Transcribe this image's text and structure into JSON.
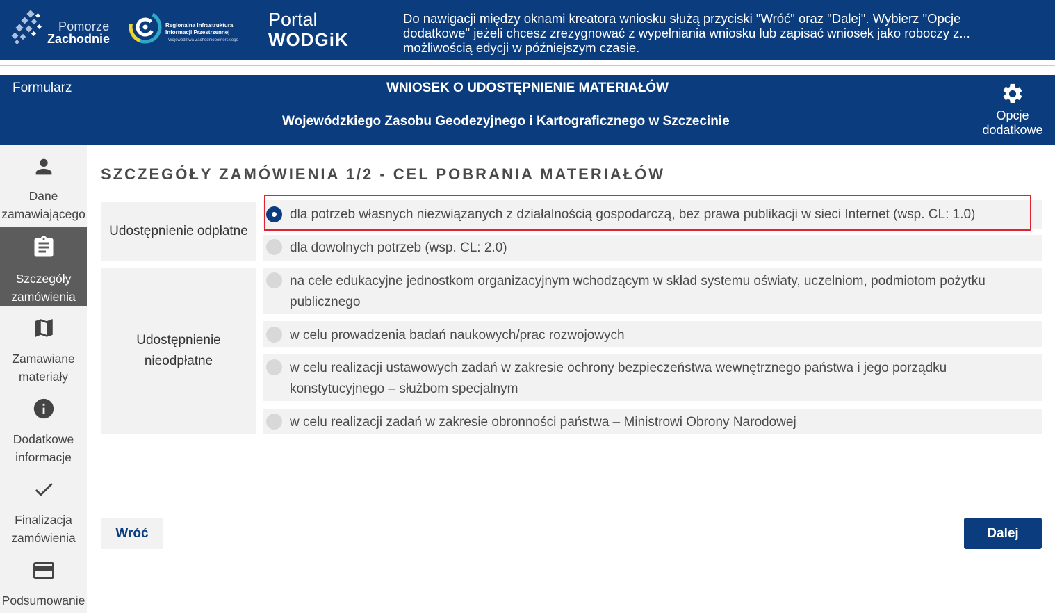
{
  "header": {
    "logo_pomorze_line1": "Pomorze",
    "logo_pomorze_line2": "Zachodnie",
    "logo_riip_line1": "Regionalna Infrastruktura",
    "logo_riip_line2": "Informacji Przestrzennej",
    "logo_riip_line3": "Województwa Zachodniopomorskiego",
    "portal_line1": "Portal",
    "portal_line2": "WODGiK",
    "info": "Do nawigacji między oknami kreatora wniosku służą przyciski \"Wróć\" oraz \"Dalej\". Wybierz \"Opcje dodatkowe\" jeżeli chcesz zrezygnować z wypełniania wniosku lub zapisać wniosek jako roboczy z... możliwością edycji w późniejszym czasie."
  },
  "form_header": {
    "label": "Formularz",
    "title": "WNIOSEK O UDOSTĘPNIENIE MATERIAŁÓW",
    "subtitle": "Wojewódzkiego Zasobu Geodezyjnego i Kartograficznego w Szczecinie",
    "options_line1": "Opcje",
    "options_line2": "dodatkowe",
    "options_icon": "gear-icon"
  },
  "sidebar": {
    "steps": [
      {
        "line1": "Dane",
        "line2": "zamawiającego",
        "icon": "person-icon",
        "active": false
      },
      {
        "line1": "Szczegóły",
        "line2": "zamówienia",
        "icon": "clipboard-icon",
        "active": true
      },
      {
        "line1": "Zamawiane",
        "line2": "materiały",
        "icon": "map-icon",
        "active": false
      },
      {
        "line1": "Dodatkowe",
        "line2": "informacje",
        "icon": "info-icon",
        "active": false
      },
      {
        "line1": "Finalizacja",
        "line2": "zamówienia",
        "icon": "check-icon",
        "active": false
      },
      {
        "line1": "Podsumowanie",
        "line2": "",
        "icon": "credit-card-icon",
        "active": false
      }
    ]
  },
  "main": {
    "title": "SZCZEGÓŁY ZAMÓWIENIA 1/2 - CEL POBRANIA MATERIAŁÓW",
    "groups": [
      {
        "label": "Udostępnienie odpłatne",
        "options": [
          {
            "text": "dla potrzeb własnych niezwiązanych z działalnością gospodarczą, bez prawa publikacji w sieci Internet (wsp. CL: 1.0)",
            "checked": true
          },
          {
            "text": "dla dowolnych potrzeb (wsp. CL: 2.0)",
            "checked": false
          }
        ]
      },
      {
        "label_line1": "Udostępnienie",
        "label_line2": "nieodpłatne",
        "options": [
          {
            "line1": "na cele edukacyjne jednostkom organizacyjnym wchodzącym w skład systemu oświaty, uczelniom, podmiotom pożytku",
            "line2": "publicznego",
            "checked": false
          },
          {
            "text": "w celu prowadzenia badań naukowych/prac rozwojowych",
            "checked": false
          },
          {
            "line1": "w celu realizacji ustawowych zadań w zakresie ochrony bezpieczeństwa wewnętrznego państwa i jego porządku",
            "line2": "konstytucyjnego – służbom specjalnym",
            "checked": false
          },
          {
            "text": "w celu realizacji zadań w zakresie obronności państwa – Ministrowi Obrony Narodowej",
            "checked": false
          }
        ]
      }
    ]
  },
  "buttons": {
    "back": "Wróć",
    "next": "Dalej"
  },
  "colors": {
    "brand_blue": "#0b3c7d",
    "highlight_red": "#e0232e",
    "panel_gray": "#f2f2f2"
  }
}
